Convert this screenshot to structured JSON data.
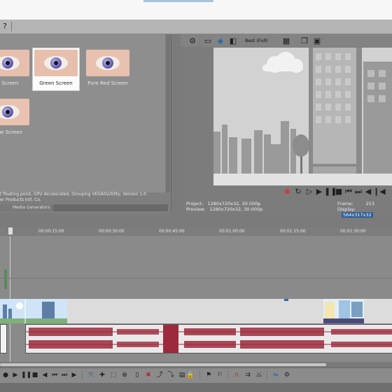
{
  "fx_presets": [
    {
      "label": "Blue Screen",
      "selected": false
    },
    {
      "label": "Green Screen",
      "selected": true
    },
    {
      "label": "Pure Red Screen",
      "selected": false
    },
    {
      "label": "Blue Screen",
      "selected": false
    }
  ],
  "fx_preset_labels": [
    "e Screen",
    "Green Screen",
    "Pure Red Screen",
    "Blue Screen"
  ],
  "fx_info": {
    "line1": "t floating point, GPU Accelerated, Grouping VEGAS\\Utility, Version 1.0",
    "line2": "er Products Intl. Co."
  },
  "tabs": {
    "media_generators": "Media Generators"
  },
  "preview": {
    "quality": "Best (Full)",
    "project_label": "Project:",
    "project_value": "1280x720x32, 30.000p",
    "preview_label": "Preview:",
    "preview_value": "1280x720x32, 30.000p",
    "frame_label": "Frame:",
    "frame_value": "253",
    "display_label": "Display:",
    "display_value": "564x317x32"
  },
  "ruler": {
    "ticks": [
      "00:00:15:00",
      "00:00:30:00",
      "00:00:45:00",
      "00:01:00:00",
      "00:01:15:00",
      "00:01:30:00"
    ]
  },
  "icons": {
    "toolbar": [
      "help-icon",
      "gear-icon",
      "split-icon",
      "video-scopes-icon",
      "grid-icon",
      "copy-icon",
      "save-icon"
    ],
    "transport": [
      "record-icon",
      "loop-icon",
      "play-icon",
      "pause-icon",
      "stop-icon",
      "prev-frame-icon",
      "next-frame-icon",
      "volume-icon"
    ]
  },
  "colors": {
    "selection": "#fbfbfb",
    "audio_wave": "#9c2a3c",
    "record": "#d23b3b"
  }
}
